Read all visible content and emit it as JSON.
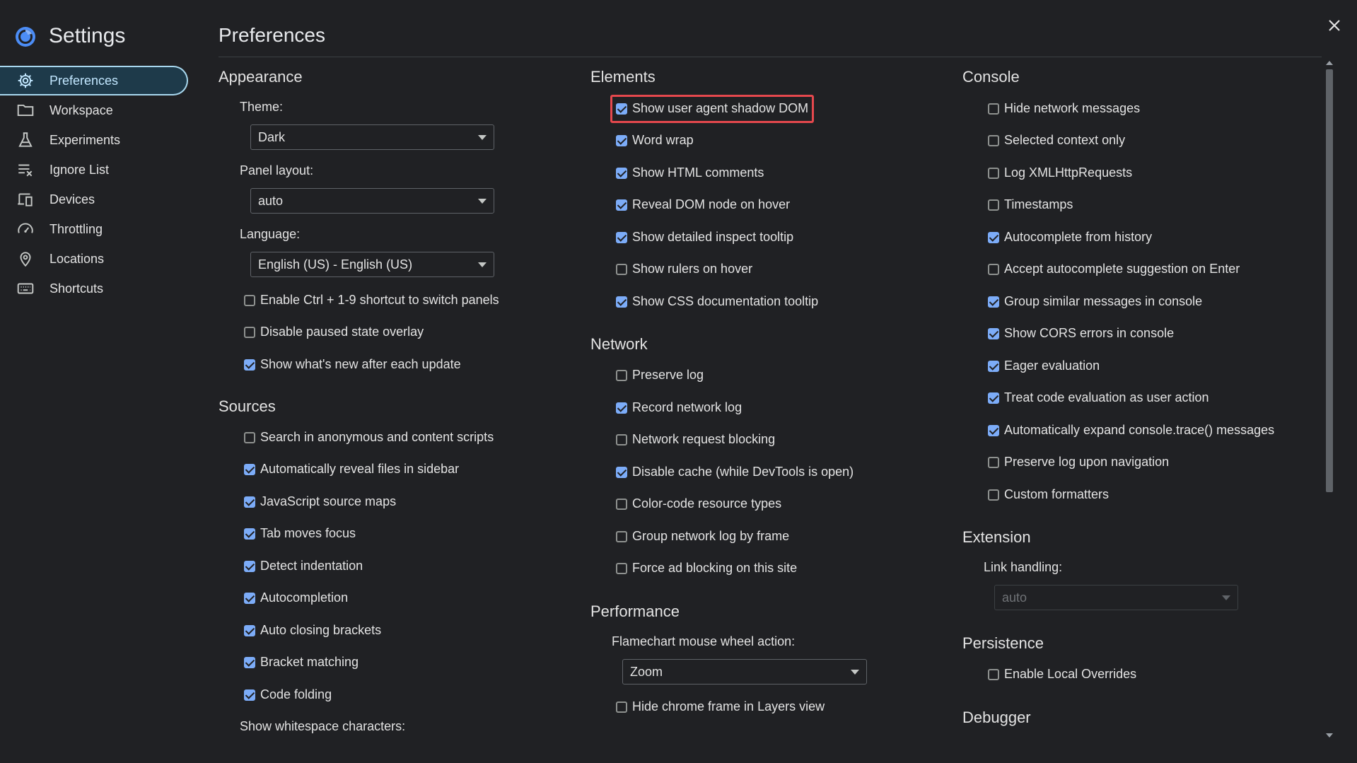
{
  "app": {
    "title": "Settings"
  },
  "sidebar": {
    "items": [
      {
        "label": "Preferences",
        "icon": "gear-icon"
      },
      {
        "label": "Workspace",
        "icon": "folder-icon"
      },
      {
        "label": "Experiments",
        "icon": "flask-icon"
      },
      {
        "label": "Ignore List",
        "icon": "ignore-list-icon"
      },
      {
        "label": "Devices",
        "icon": "devices-icon"
      },
      {
        "label": "Throttling",
        "icon": "speedometer-icon"
      },
      {
        "label": "Locations",
        "icon": "location-pin-icon"
      },
      {
        "label": "Shortcuts",
        "icon": "keyboard-icon"
      }
    ]
  },
  "page": {
    "title": "Preferences"
  },
  "appearance": {
    "title": "Appearance",
    "theme_label": "Theme:",
    "theme_value": "Dark",
    "panel_layout_label": "Panel layout:",
    "panel_layout_value": "auto",
    "language_label": "Language:",
    "language_value": "English (US) - English (US)",
    "checkboxes": [
      {
        "label": "Enable Ctrl + 1-9 shortcut to switch panels",
        "checked": false
      },
      {
        "label": "Disable paused state overlay",
        "checked": false
      },
      {
        "label": "Show what's new after each update",
        "checked": true
      }
    ]
  },
  "sources": {
    "title": "Sources",
    "checkboxes": [
      {
        "label": "Search in anonymous and content scripts",
        "checked": false
      },
      {
        "label": "Automatically reveal files in sidebar",
        "checked": true
      },
      {
        "label": "JavaScript source maps",
        "checked": true
      },
      {
        "label": "Tab moves focus",
        "checked": true
      },
      {
        "label": "Detect indentation",
        "checked": true
      },
      {
        "label": "Autocompletion",
        "checked": true
      },
      {
        "label": "Auto closing brackets",
        "checked": true
      },
      {
        "label": "Bracket matching",
        "checked": true
      },
      {
        "label": "Code folding",
        "checked": true
      }
    ],
    "whitespace_label": "Show whitespace characters:"
  },
  "elements": {
    "title": "Elements",
    "checkboxes": [
      {
        "label": "Show user agent shadow DOM",
        "checked": true
      },
      {
        "label": "Word wrap",
        "checked": true
      },
      {
        "label": "Show HTML comments",
        "checked": true
      },
      {
        "label": "Reveal DOM node on hover",
        "checked": true
      },
      {
        "label": "Show detailed inspect tooltip",
        "checked": true
      },
      {
        "label": "Show rulers on hover",
        "checked": false
      },
      {
        "label": "Show CSS documentation tooltip",
        "checked": true
      }
    ]
  },
  "network": {
    "title": "Network",
    "checkboxes": [
      {
        "label": "Preserve log",
        "checked": false
      },
      {
        "label": "Record network log",
        "checked": true
      },
      {
        "label": "Network request blocking",
        "checked": false
      },
      {
        "label": "Disable cache (while DevTools is open)",
        "checked": true
      },
      {
        "label": "Color-code resource types",
        "checked": false
      },
      {
        "label": "Group network log by frame",
        "checked": false
      },
      {
        "label": "Force ad blocking on this site",
        "checked": false
      }
    ]
  },
  "performance": {
    "title": "Performance",
    "flamechart_label": "Flamechart mouse wheel action:",
    "flamechart_value": "Zoom",
    "checkboxes": [
      {
        "label": "Hide chrome frame in Layers view",
        "checked": false
      }
    ]
  },
  "console": {
    "title": "Console",
    "checkboxes": [
      {
        "label": "Hide network messages",
        "checked": false
      },
      {
        "label": "Selected context only",
        "checked": false
      },
      {
        "label": "Log XMLHttpRequests",
        "checked": false
      },
      {
        "label": "Timestamps",
        "checked": false
      },
      {
        "label": "Autocomplete from history",
        "checked": true
      },
      {
        "label": "Accept autocomplete suggestion on Enter",
        "checked": false
      },
      {
        "label": "Group similar messages in console",
        "checked": true
      },
      {
        "label": "Show CORS errors in console",
        "checked": true
      },
      {
        "label": "Eager evaluation",
        "checked": true
      },
      {
        "label": "Treat code evaluation as user action",
        "checked": true
      },
      {
        "label": "Automatically expand console.trace() messages",
        "checked": true
      },
      {
        "label": "Preserve log upon navigation",
        "checked": false
      },
      {
        "label": "Custom formatters",
        "checked": false
      }
    ]
  },
  "extension": {
    "title": "Extension",
    "link_handling_label": "Link handling:",
    "link_handling_value": "auto"
  },
  "persistence": {
    "title": "Persistence",
    "checkboxes": [
      {
        "label": "Enable Local Overrides",
        "checked": false
      }
    ]
  },
  "debugger": {
    "title": "Debugger"
  },
  "colors": {
    "accent": "#7cacf8",
    "highlight": "#e5484d",
    "background": "#202124"
  }
}
